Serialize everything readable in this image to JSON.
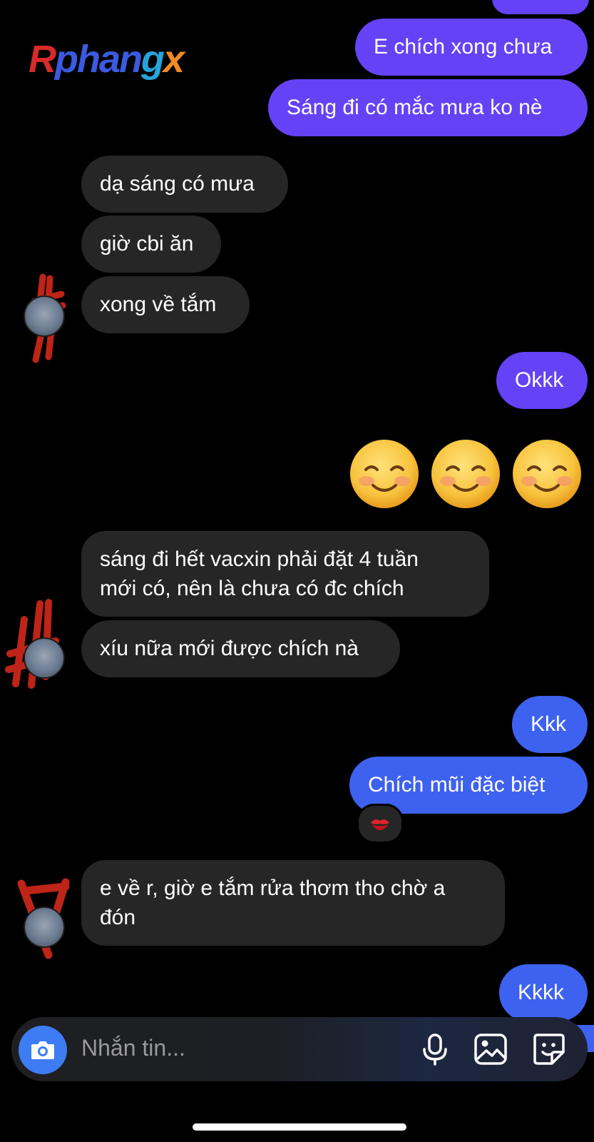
{
  "logo": {
    "part1": "R",
    "part2": "phan",
    "part3": "g",
    "part4": "x"
  },
  "messages": [
    {
      "id": "m1",
      "side": "out",
      "text": "E chích xong chưa"
    },
    {
      "id": "m2",
      "side": "out",
      "text": "Sáng đi có mắc mưa ko nè"
    },
    {
      "id": "m3",
      "side": "in",
      "text": "dạ sáng có mưa"
    },
    {
      "id": "m4",
      "side": "in",
      "text": "giờ cbi ăn"
    },
    {
      "id": "m5",
      "side": "in",
      "text": "xong về tắm"
    },
    {
      "id": "m6",
      "side": "out",
      "text": "Okkk"
    },
    {
      "id": "m7",
      "side": "out",
      "emoji": "smiling-face-with-smiling-eyes",
      "count": 3
    },
    {
      "id": "m8",
      "side": "in",
      "line1": "sáng đi hết vacxin phải đặt 4 tuần",
      "line2": "mới có, nên là chưa có đc chích"
    },
    {
      "id": "m9",
      "side": "in",
      "text": "xíu nữa mới được chích nà"
    },
    {
      "id": "m10",
      "side": "out",
      "text": "Kkk"
    },
    {
      "id": "m11",
      "side": "out",
      "text": "Chích mũi đặc biệt",
      "reaction": "kiss-mark"
    },
    {
      "id": "m12",
      "side": "in",
      "line1": "e về r, giờ e tắm rửa thơm tho chờ a",
      "line2": "đón"
    },
    {
      "id": "m13",
      "side": "out",
      "text": "Kkkk"
    }
  ],
  "composer": {
    "placeholder": "Nhắn tin...",
    "icons": [
      "camera-icon",
      "microphone-icon",
      "image-icon",
      "sticker-icon"
    ]
  },
  "colors": {
    "outgoing_purple": "#6542f5",
    "outgoing_blue": "#3e62f0",
    "incoming": "#262626",
    "camera_button": "#3d7cf3",
    "background": "#000000"
  }
}
